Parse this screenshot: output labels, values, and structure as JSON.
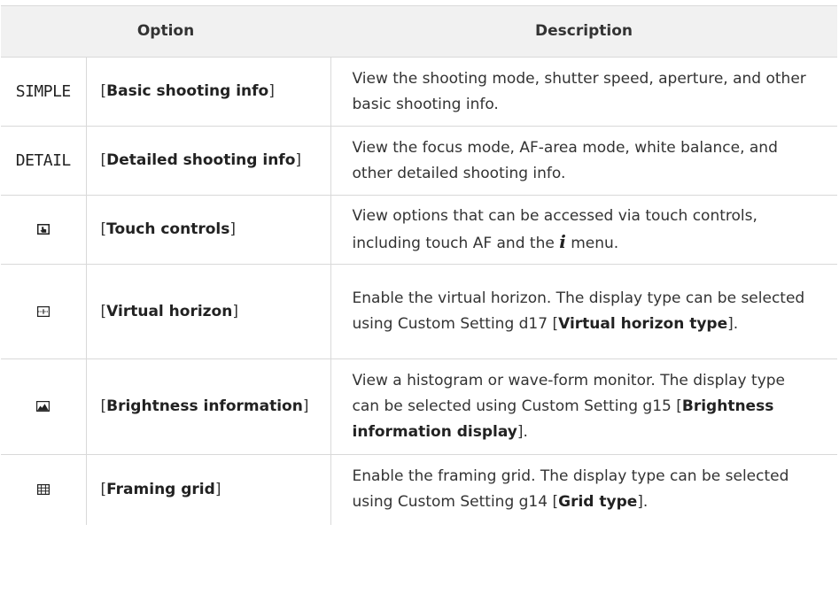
{
  "table": {
    "headers": {
      "option": "Option",
      "description": "Description"
    },
    "rows": [
      {
        "icon_text": "SIMPLE",
        "name": "Basic shooting info",
        "desc": "View the shooting mode, shutter speed, aperture, and other basic shooting info."
      },
      {
        "icon_text": "DETAIL",
        "name": "Detailed shooting info",
        "desc": "View the focus mode, AF-area mode, white balance, and other detailed shooting info."
      },
      {
        "icon": "touch-controls-icon",
        "name": "Touch controls",
        "desc_a": "View options that can be accessed via touch controls, including touch AF and the ",
        "desc_i": "i",
        "desc_b": " menu."
      },
      {
        "icon": "virtual-horizon-icon",
        "name": "Virtual horizon",
        "desc_a": "Enable the virtual horizon. The display type can be selected using Custom Setting d17 [",
        "desc_bold": "Virtual horizon type",
        "desc_b": "]."
      },
      {
        "icon": "brightness-icon",
        "name": "Brightness information",
        "desc_a": "View a histogram or wave-form monitor. The display type can be selected using Custom Setting g15 [",
        "desc_bold": "Brightness information display",
        "desc_b": "]."
      },
      {
        "icon": "grid-icon",
        "name": "Framing grid",
        "desc_a": "Enable the framing grid. The display type can be selected using Custom Setting g14 [",
        "desc_bold": "Grid type",
        "desc_b": "]."
      }
    ],
    "open_bracket": "[",
    "close_bracket": "]"
  }
}
